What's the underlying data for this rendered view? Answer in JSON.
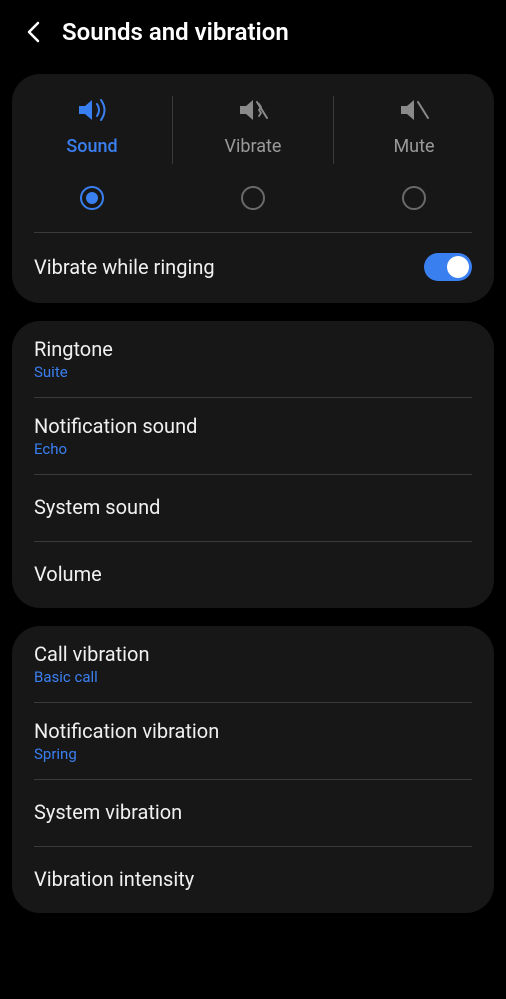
{
  "header": {
    "title": "Sounds and vibration"
  },
  "modes": {
    "sound": {
      "label": "Sound",
      "selected": true
    },
    "vibrate": {
      "label": "Vibrate",
      "selected": false
    },
    "mute": {
      "label": "Mute",
      "selected": false
    }
  },
  "vibrateWhileRinging": {
    "label": "Vibrate while ringing",
    "enabled": true
  },
  "soundSettings": {
    "ringtone": {
      "title": "Ringtone",
      "value": "Suite"
    },
    "notificationSound": {
      "title": "Notification sound",
      "value": "Echo"
    },
    "systemSound": {
      "title": "System sound"
    },
    "volume": {
      "title": "Volume"
    }
  },
  "vibrationSettings": {
    "callVibration": {
      "title": "Call vibration",
      "value": "Basic call"
    },
    "notificationVibration": {
      "title": "Notification vibration",
      "value": "Spring"
    },
    "systemVibration": {
      "title": "System vibration"
    },
    "vibrationIntensity": {
      "title": "Vibration intensity"
    }
  },
  "colors": {
    "accent": "#3a7ff0",
    "background": "#000000",
    "card": "#171717",
    "textPrimary": "#f0f0f0",
    "textSecondary": "#9a9a9a"
  }
}
